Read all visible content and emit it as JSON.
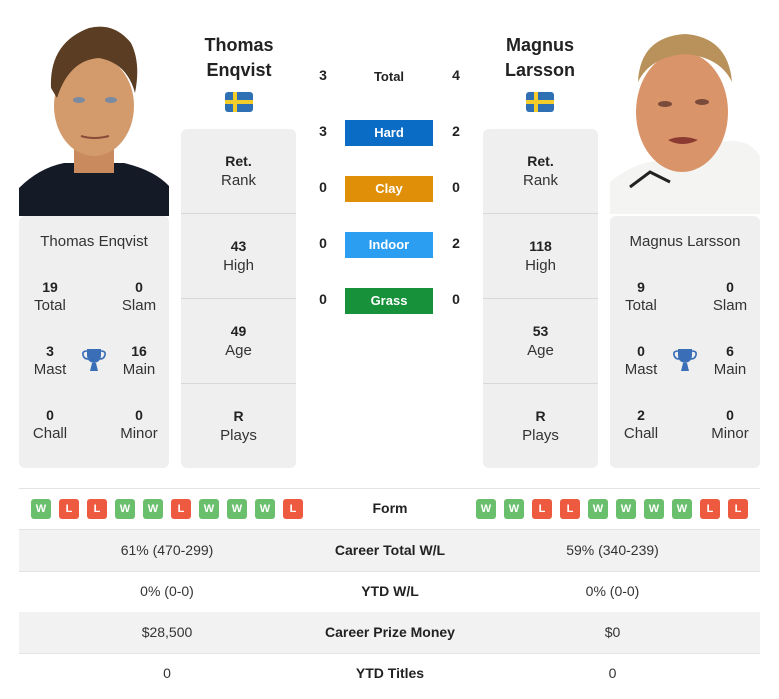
{
  "players": [
    {
      "name_line1": "Thomas",
      "name_line2": "Enqvist",
      "full_name": "Thomas Enqvist",
      "country_flag": "sweden-flag",
      "titles": {
        "total": "19",
        "total_label": "Total",
        "slam": "0",
        "slam_label": "Slam",
        "mast": "3",
        "mast_label": "Mast",
        "main": "16",
        "main_label": "Main",
        "chall": "0",
        "chall_label": "Chall",
        "minor": "0",
        "minor_label": "Minor"
      },
      "rank": {
        "value": "Ret.",
        "label": "Rank"
      },
      "high": {
        "value": "43",
        "label": "High"
      },
      "age": {
        "value": "49",
        "label": "Age"
      },
      "plays": {
        "value": "R",
        "label": "Plays"
      },
      "form": [
        "W",
        "L",
        "L",
        "W",
        "W",
        "L",
        "W",
        "W",
        "W",
        "L"
      ]
    },
    {
      "name_line1": "Magnus",
      "name_line2": "Larsson",
      "full_name": "Magnus Larsson",
      "country_flag": "sweden-flag",
      "titles": {
        "total": "9",
        "total_label": "Total",
        "slam": "0",
        "slam_label": "Slam",
        "mast": "0",
        "mast_label": "Mast",
        "main": "6",
        "main_label": "Main",
        "chall": "2",
        "chall_label": "Chall",
        "minor": "0",
        "minor_label": "Minor"
      },
      "rank": {
        "value": "Ret.",
        "label": "Rank"
      },
      "high": {
        "value": "118",
        "label": "High"
      },
      "age": {
        "value": "53",
        "label": "Age"
      },
      "plays": {
        "value": "R",
        "label": "Plays"
      },
      "form": [
        "W",
        "W",
        "L",
        "L",
        "W",
        "W",
        "W",
        "W",
        "L",
        "L"
      ]
    }
  ],
  "h2h": {
    "total": {
      "label": "Total",
      "p1": "3",
      "p2": "4"
    },
    "surfaces": [
      {
        "label": "Hard",
        "p1": "3",
        "p2": "2",
        "color": "#0a6cc4"
      },
      {
        "label": "Clay",
        "p1": "0",
        "p2": "0",
        "color": "#df9008"
      },
      {
        "label": "Indoor",
        "p1": "0",
        "p2": "2",
        "color": "#2b9ef2"
      },
      {
        "label": "Grass",
        "p1": "0",
        "p2": "0",
        "color": "#17913a"
      }
    ]
  },
  "form_label": "Form",
  "comparison": [
    {
      "label": "Career Total W/L",
      "p1": "61% (470-299)",
      "p2": "59% (340-239)"
    },
    {
      "label": "YTD W/L",
      "p1": "0% (0-0)",
      "p2": "0% (0-0)"
    },
    {
      "label": "Career Prize Money",
      "p1": "$28,500",
      "p2": "$0"
    },
    {
      "label": "YTD Titles",
      "p1": "0",
      "p2": "0"
    }
  ],
  "colors": {
    "win": "#6abf6d",
    "loss": "#ed5a3f",
    "trophy": "#3a6fb8",
    "card_bg": "#efefef"
  }
}
